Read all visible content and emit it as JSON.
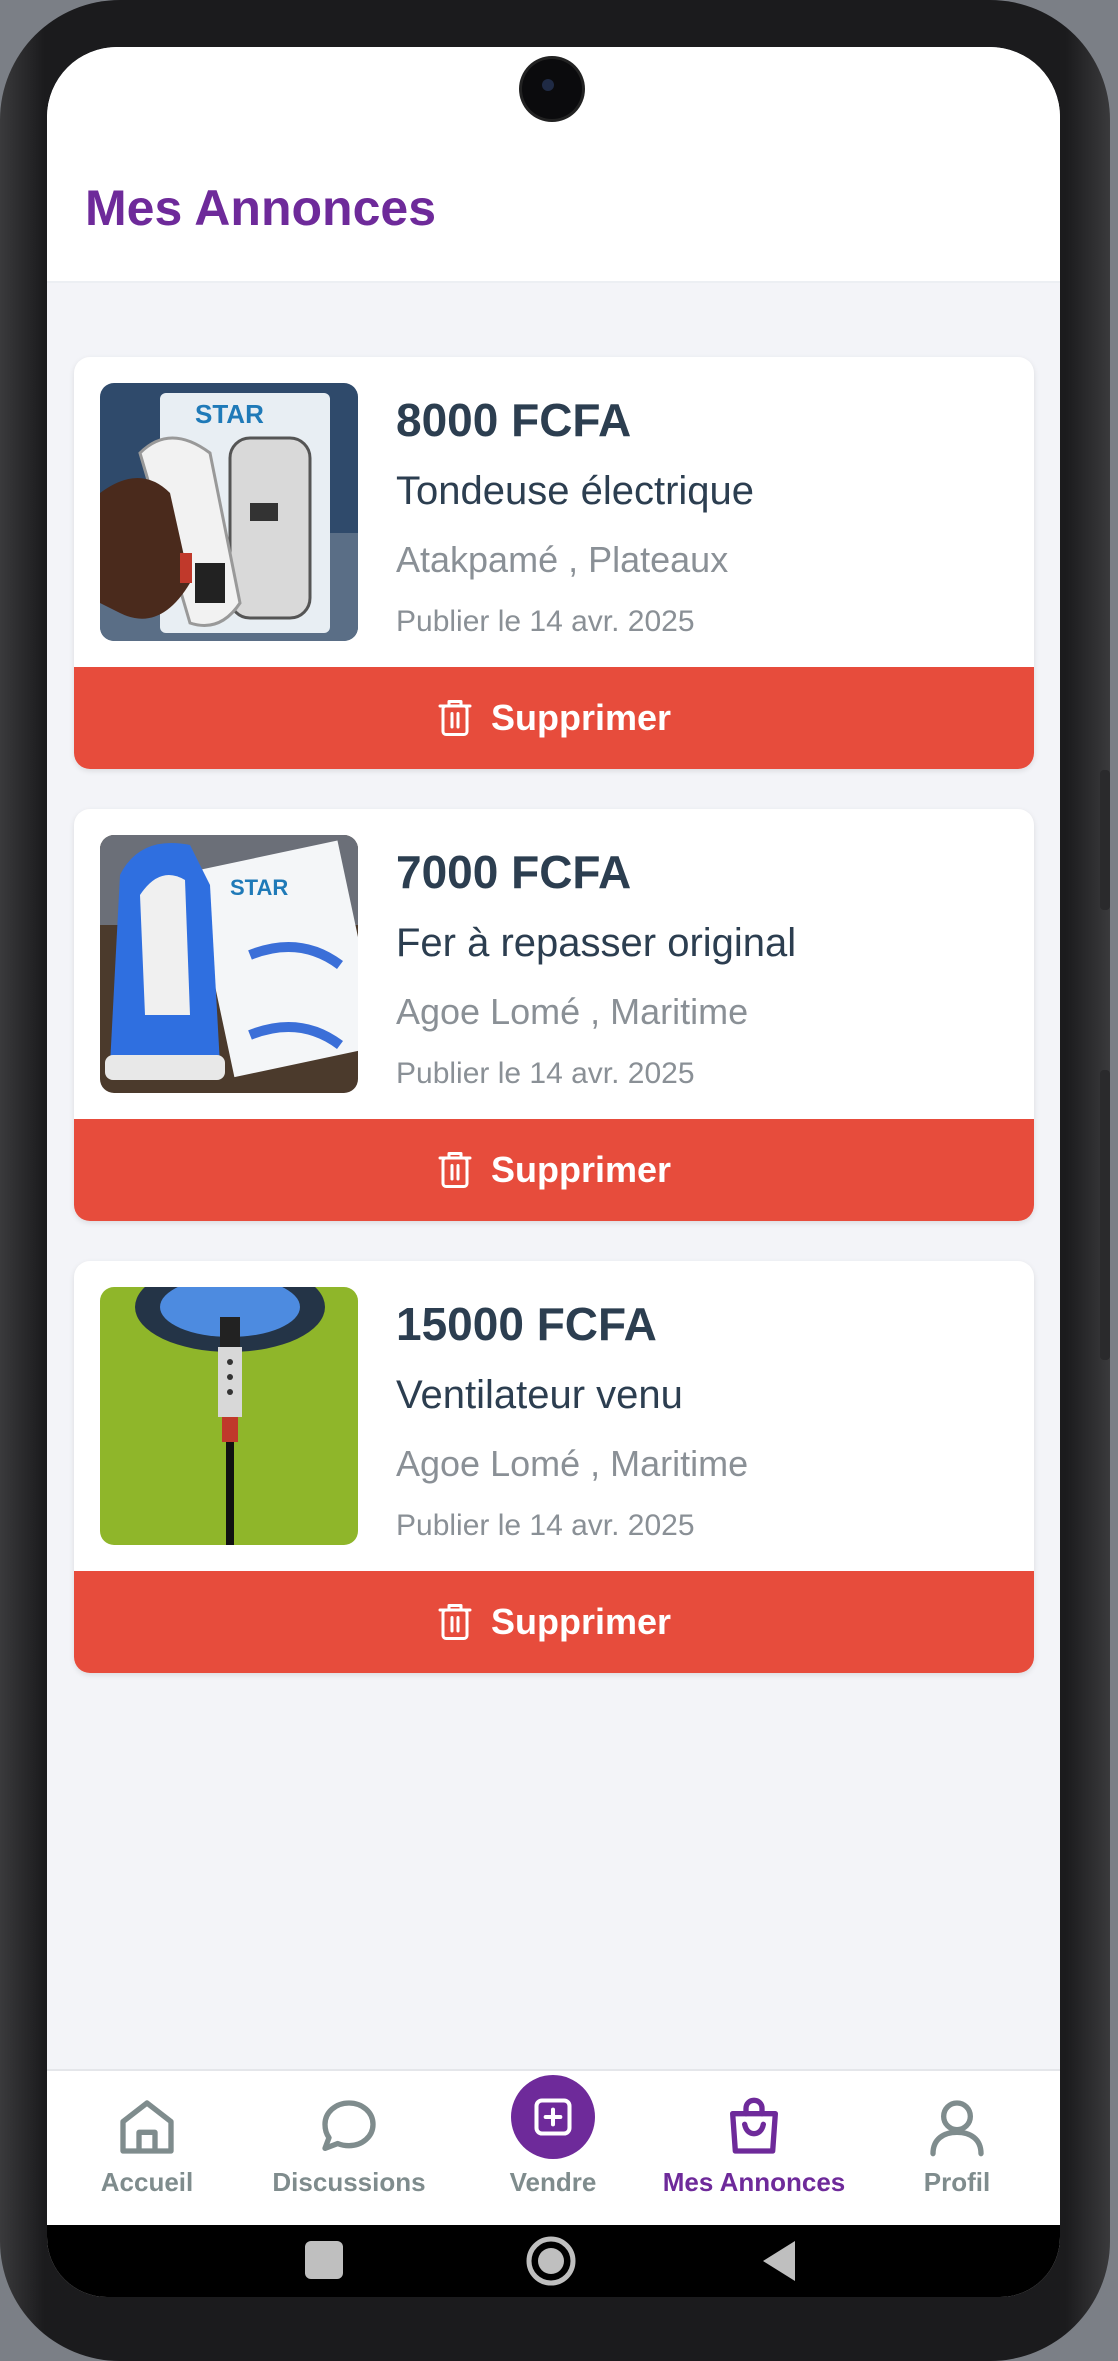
{
  "header": {
    "title": "Mes Annonces"
  },
  "listings": [
    {
      "price": "8000 FCFA",
      "title": "Tondeuse électrique",
      "location": "Atakpamé , Plateaux",
      "date": "Publier le 14 avr. 2025",
      "delete_label": "Supprimer",
      "image": "hair-clipper-photo"
    },
    {
      "price": "7000 FCFA",
      "title": "Fer à repasser original",
      "location": "Agoe Lomé , Maritime",
      "date": "Publier le 14 avr. 2025",
      "delete_label": "Supprimer",
      "image": "iron-photo"
    },
    {
      "price": "15000 FCFA",
      "title": "Ventilateur venu",
      "location": "Agoe Lomé , Maritime",
      "date": "Publier le 14 avr. 2025",
      "delete_label": "Supprimer",
      "image": "fan-photo"
    }
  ],
  "nav": {
    "items": [
      {
        "label": "Accueil",
        "icon": "home-icon"
      },
      {
        "label": "Discussions",
        "icon": "chat-icon"
      },
      {
        "label": "Vendre",
        "icon": "plus-square-icon"
      },
      {
        "label": "Mes Annonces",
        "icon": "shopping-bag-icon",
        "active": true
      },
      {
        "label": "Profil",
        "icon": "user-icon"
      }
    ]
  },
  "colors": {
    "brand": "#6e2a9a",
    "danger": "#e74c3c",
    "text_dark": "#2c3e50",
    "text_muted": "#8a9096",
    "background": "#f3f4f8"
  }
}
